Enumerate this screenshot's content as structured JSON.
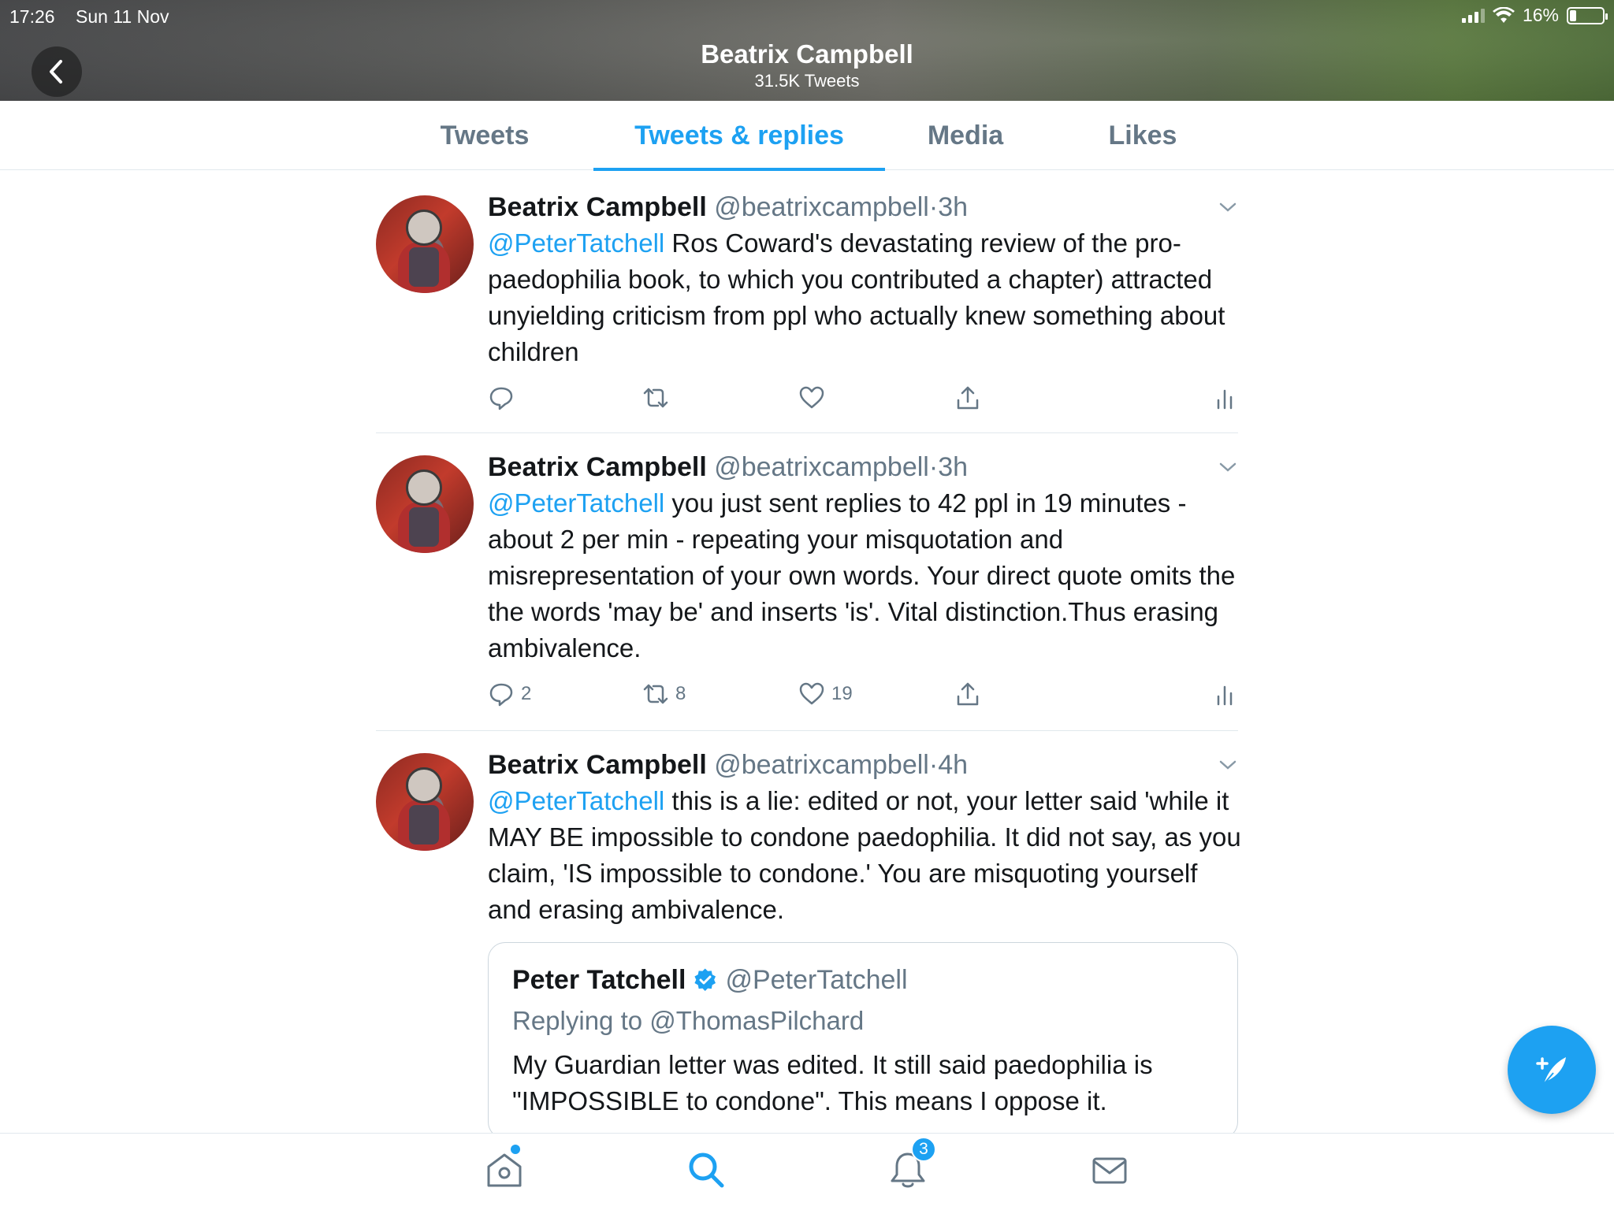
{
  "status_bar": {
    "time": "17:26",
    "date": "Sun 11 Nov",
    "battery": "16%"
  },
  "header": {
    "title": "Beatrix Campbell",
    "subtitle": "31.5K Tweets"
  },
  "tabs": [
    {
      "label": "Tweets"
    },
    {
      "label": "Tweets & replies"
    },
    {
      "label": "Media"
    },
    {
      "label": "Likes"
    }
  ],
  "tweets": [
    {
      "name": "Beatrix Campbell",
      "handle": "@beatrixcampbell",
      "sep": "·",
      "time": "3h",
      "mention": "@PeterTatchell",
      "text": " Ros Coward's devastating review of the pro-paedophilia book, to which you contributed a chapter) attracted unyielding criticism from ppl who actually knew something about children",
      "replies": "",
      "retweets": "",
      "likes": ""
    },
    {
      "name": "Beatrix Campbell",
      "handle": "@beatrixcampbell",
      "sep": "·",
      "time": "3h",
      "mention": "@PeterTatchell",
      "text": " you just sent replies to 42 ppl in 19 minutes - about 2 per min - repeating your misquotation and misrepresentation of your own words. Your direct quote omits the the words 'may be' and inserts 'is'.  Vital distinction.Thus erasing ambivalence.",
      "replies": "2",
      "retweets": "8",
      "likes": "19"
    },
    {
      "name": "Beatrix Campbell",
      "handle": "@beatrixcampbell",
      "sep": "·",
      "time": "4h",
      "mention": "@PeterTatchell",
      "text": " this is a lie: edited or not, your letter said 'while it MAY BE impossible to condone paedophilia. It did not say, as you claim, 'IS impossible to condone.' You are misquoting yourself and erasing ambivalence.",
      "quote": {
        "name": "Peter Tatchell",
        "handle": "@PeterTatchell",
        "replying": "Replying to @ThomasPilchard",
        "text": "My Guardian letter was edited. It still said paedophilia is \"IMPOSSIBLE to condone\". This means I oppose it."
      }
    }
  ],
  "bottom_nav": {
    "notifications_badge": "3"
  },
  "colors": {
    "accent": "#1da1f2",
    "muted": "#657786"
  }
}
